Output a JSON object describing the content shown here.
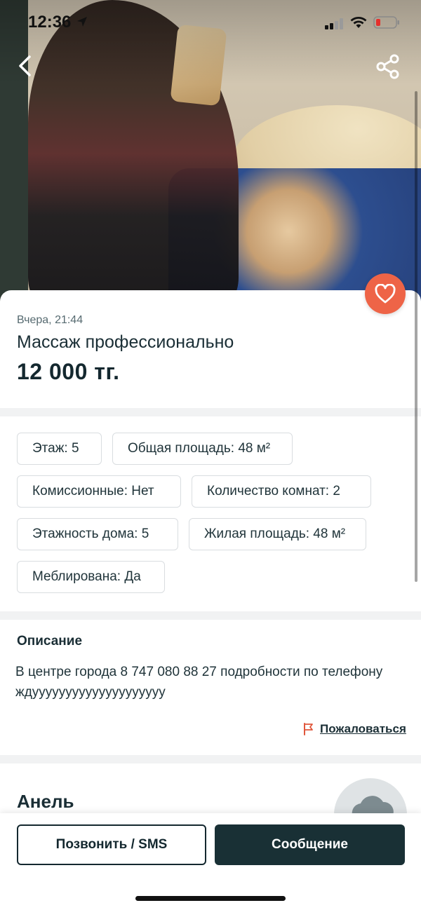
{
  "status_bar": {
    "time": "12:36"
  },
  "listing": {
    "posted": "Вчера, 21:44",
    "title": "Массаж профессионально",
    "price": "12 000 тг.",
    "attributes": [
      "Этаж: 5",
      "Общая площадь: 48 м²",
      "Комиссионные: Нет",
      "Количество комнат: 2",
      "Этажность дома: 5",
      "Жилая площадь: 48 м²",
      "Меблирована: Да"
    ]
  },
  "description": {
    "title": "Описание",
    "text": "В центре города 8 747 080 88 27 подробности по телефону ждуууууууууууууууууууу"
  },
  "report": {
    "label": "Пожаловаться"
  },
  "seller": {
    "name": "Анель"
  },
  "actions": {
    "call_label": "Позвонить / SMS",
    "message_label": "Сообщение"
  },
  "colors": {
    "accent": "#ee6447",
    "primary": "#193035",
    "divider": "#f1f2f3"
  },
  "icons": {
    "back": "chevron-left-icon",
    "share": "share-icon",
    "favorite": "heart-icon",
    "report": "flag-icon"
  }
}
